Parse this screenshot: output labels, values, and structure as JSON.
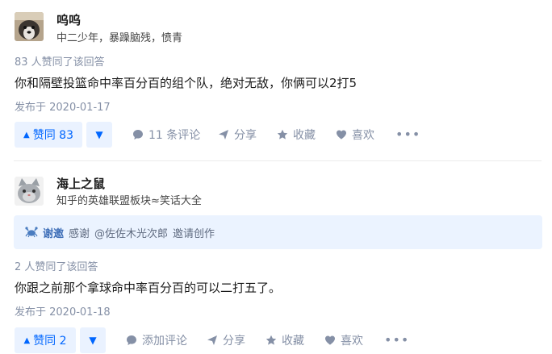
{
  "answers": [
    {
      "author": {
        "name": "呜呜",
        "bio": "中二少年，暴躁脑残，愤青"
      },
      "upvote_text": "83 人赞同了该回答",
      "content": "你和隔壁投篮命中率百分百的组个队，绝对无敌，你俩可以2打5",
      "published": "发布于 2020-01-17",
      "actions": {
        "vote_up": "赞同 83",
        "comments": "11 条评论",
        "share": "分享",
        "favorite": "收藏",
        "like": "喜欢"
      }
    },
    {
      "author": {
        "name": "海上之鼠",
        "bio": "知乎的英雄联盟板块≈笑话大全"
      },
      "thanks": {
        "label": "谢邀",
        "text1": "感谢",
        "mention": "@佐佐木光次郎",
        "text2": "邀请创作"
      },
      "upvote_text": "2 人赞同了该回答",
      "content": "你跟之前那个拿球命中率百分百的可以二打五了。",
      "published": "发布于 2020-01-18",
      "actions": {
        "vote_up": "赞同 2",
        "comments": "添加评论",
        "share": "分享",
        "favorite": "收藏",
        "like": "喜欢"
      }
    }
  ],
  "colors": {
    "accent": "#0066ff",
    "accent_bg": "#eaf2ff",
    "meta": "#8590a6",
    "thanks_bg": "#ebf3ff"
  }
}
